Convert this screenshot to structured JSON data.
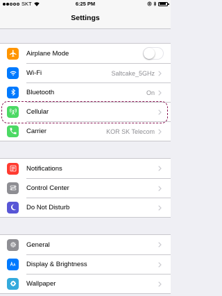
{
  "status_bar": {
    "carrier": "SKT",
    "time": "6:25 PM",
    "battery_level": 0.85
  },
  "nav": {
    "title": "Settings"
  },
  "groups": [
    {
      "items": [
        {
          "label": "Airplane Mode",
          "icon": "airplane-icon",
          "color": "#ff9500",
          "control": "toggle",
          "toggle_on": false
        },
        {
          "label": "Wi-Fi",
          "icon": "wifi-icon",
          "color": "#007aff",
          "value": "Saltcake_5GHz"
        },
        {
          "label": "Bluetooth",
          "icon": "bluetooth-icon",
          "color": "#007aff",
          "value": "On"
        },
        {
          "label": "Cellular",
          "icon": "cellular-antenna-icon",
          "color": "#4cd964",
          "value": ""
        },
        {
          "label": "Carrier",
          "icon": "phone-icon",
          "color": "#4cd964",
          "value": "KOR SK Telecom"
        }
      ]
    },
    {
      "items": [
        {
          "label": "Notifications",
          "icon": "notifications-icon",
          "color": "#ff3b30"
        },
        {
          "label": "Control Center",
          "icon": "control-center-icon",
          "color": "#8e8e93"
        },
        {
          "label": "Do Not Disturb",
          "icon": "moon-icon",
          "color": "#5856d6"
        }
      ]
    },
    {
      "items": [
        {
          "label": "General",
          "icon": "gear-icon",
          "color": "#8e8e93"
        },
        {
          "label": "Display & Brightness",
          "icon": "display-brightness-icon",
          "color": "#007aff"
        },
        {
          "label": "Wallpaper",
          "icon": "wallpaper-icon",
          "color": "#34aadc"
        }
      ]
    }
  ]
}
